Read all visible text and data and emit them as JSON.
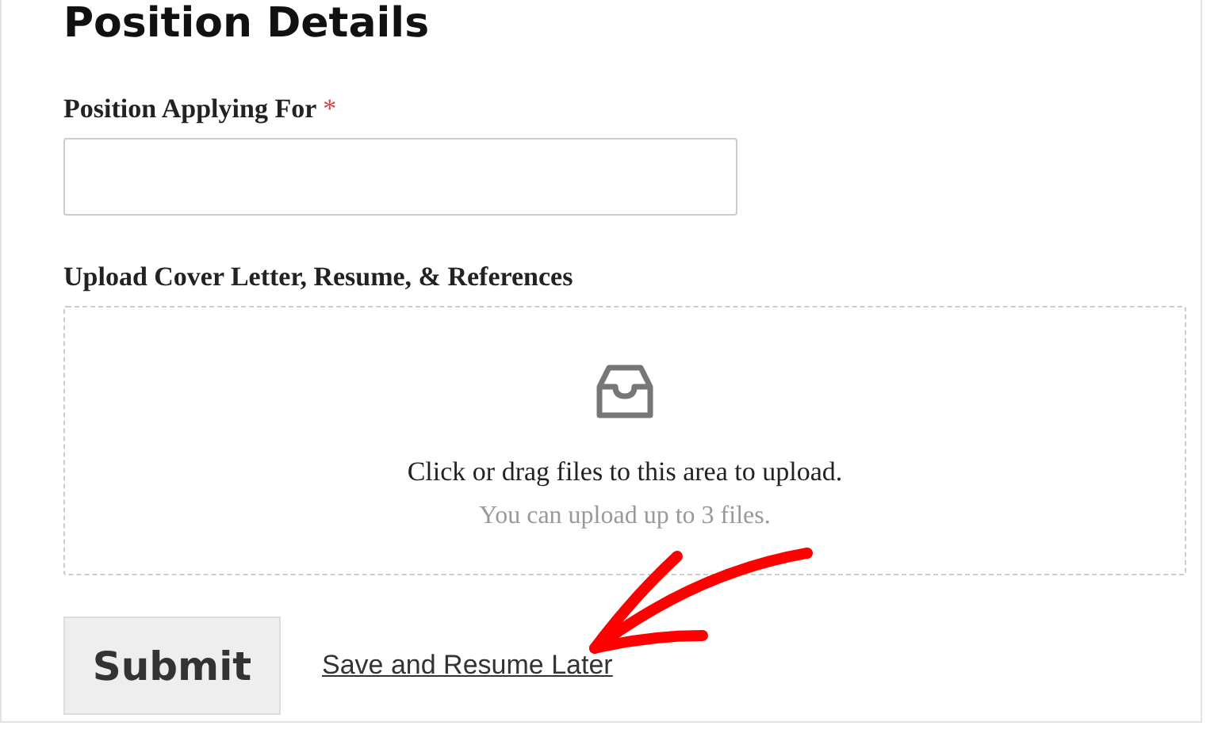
{
  "heading": "Position Details",
  "fields": [
    {
      "kind": "text",
      "label": "Position Applying For",
      "required_mark": "*"
    },
    {
      "kind": "upload",
      "label": "Upload Cover Letter, Resume, & References",
      "prompt": "Click or drag files to this area to upload.",
      "hint": "You can upload up to 3 files."
    }
  ],
  "submit": "Submit",
  "save_link": "Save and Resume Later"
}
